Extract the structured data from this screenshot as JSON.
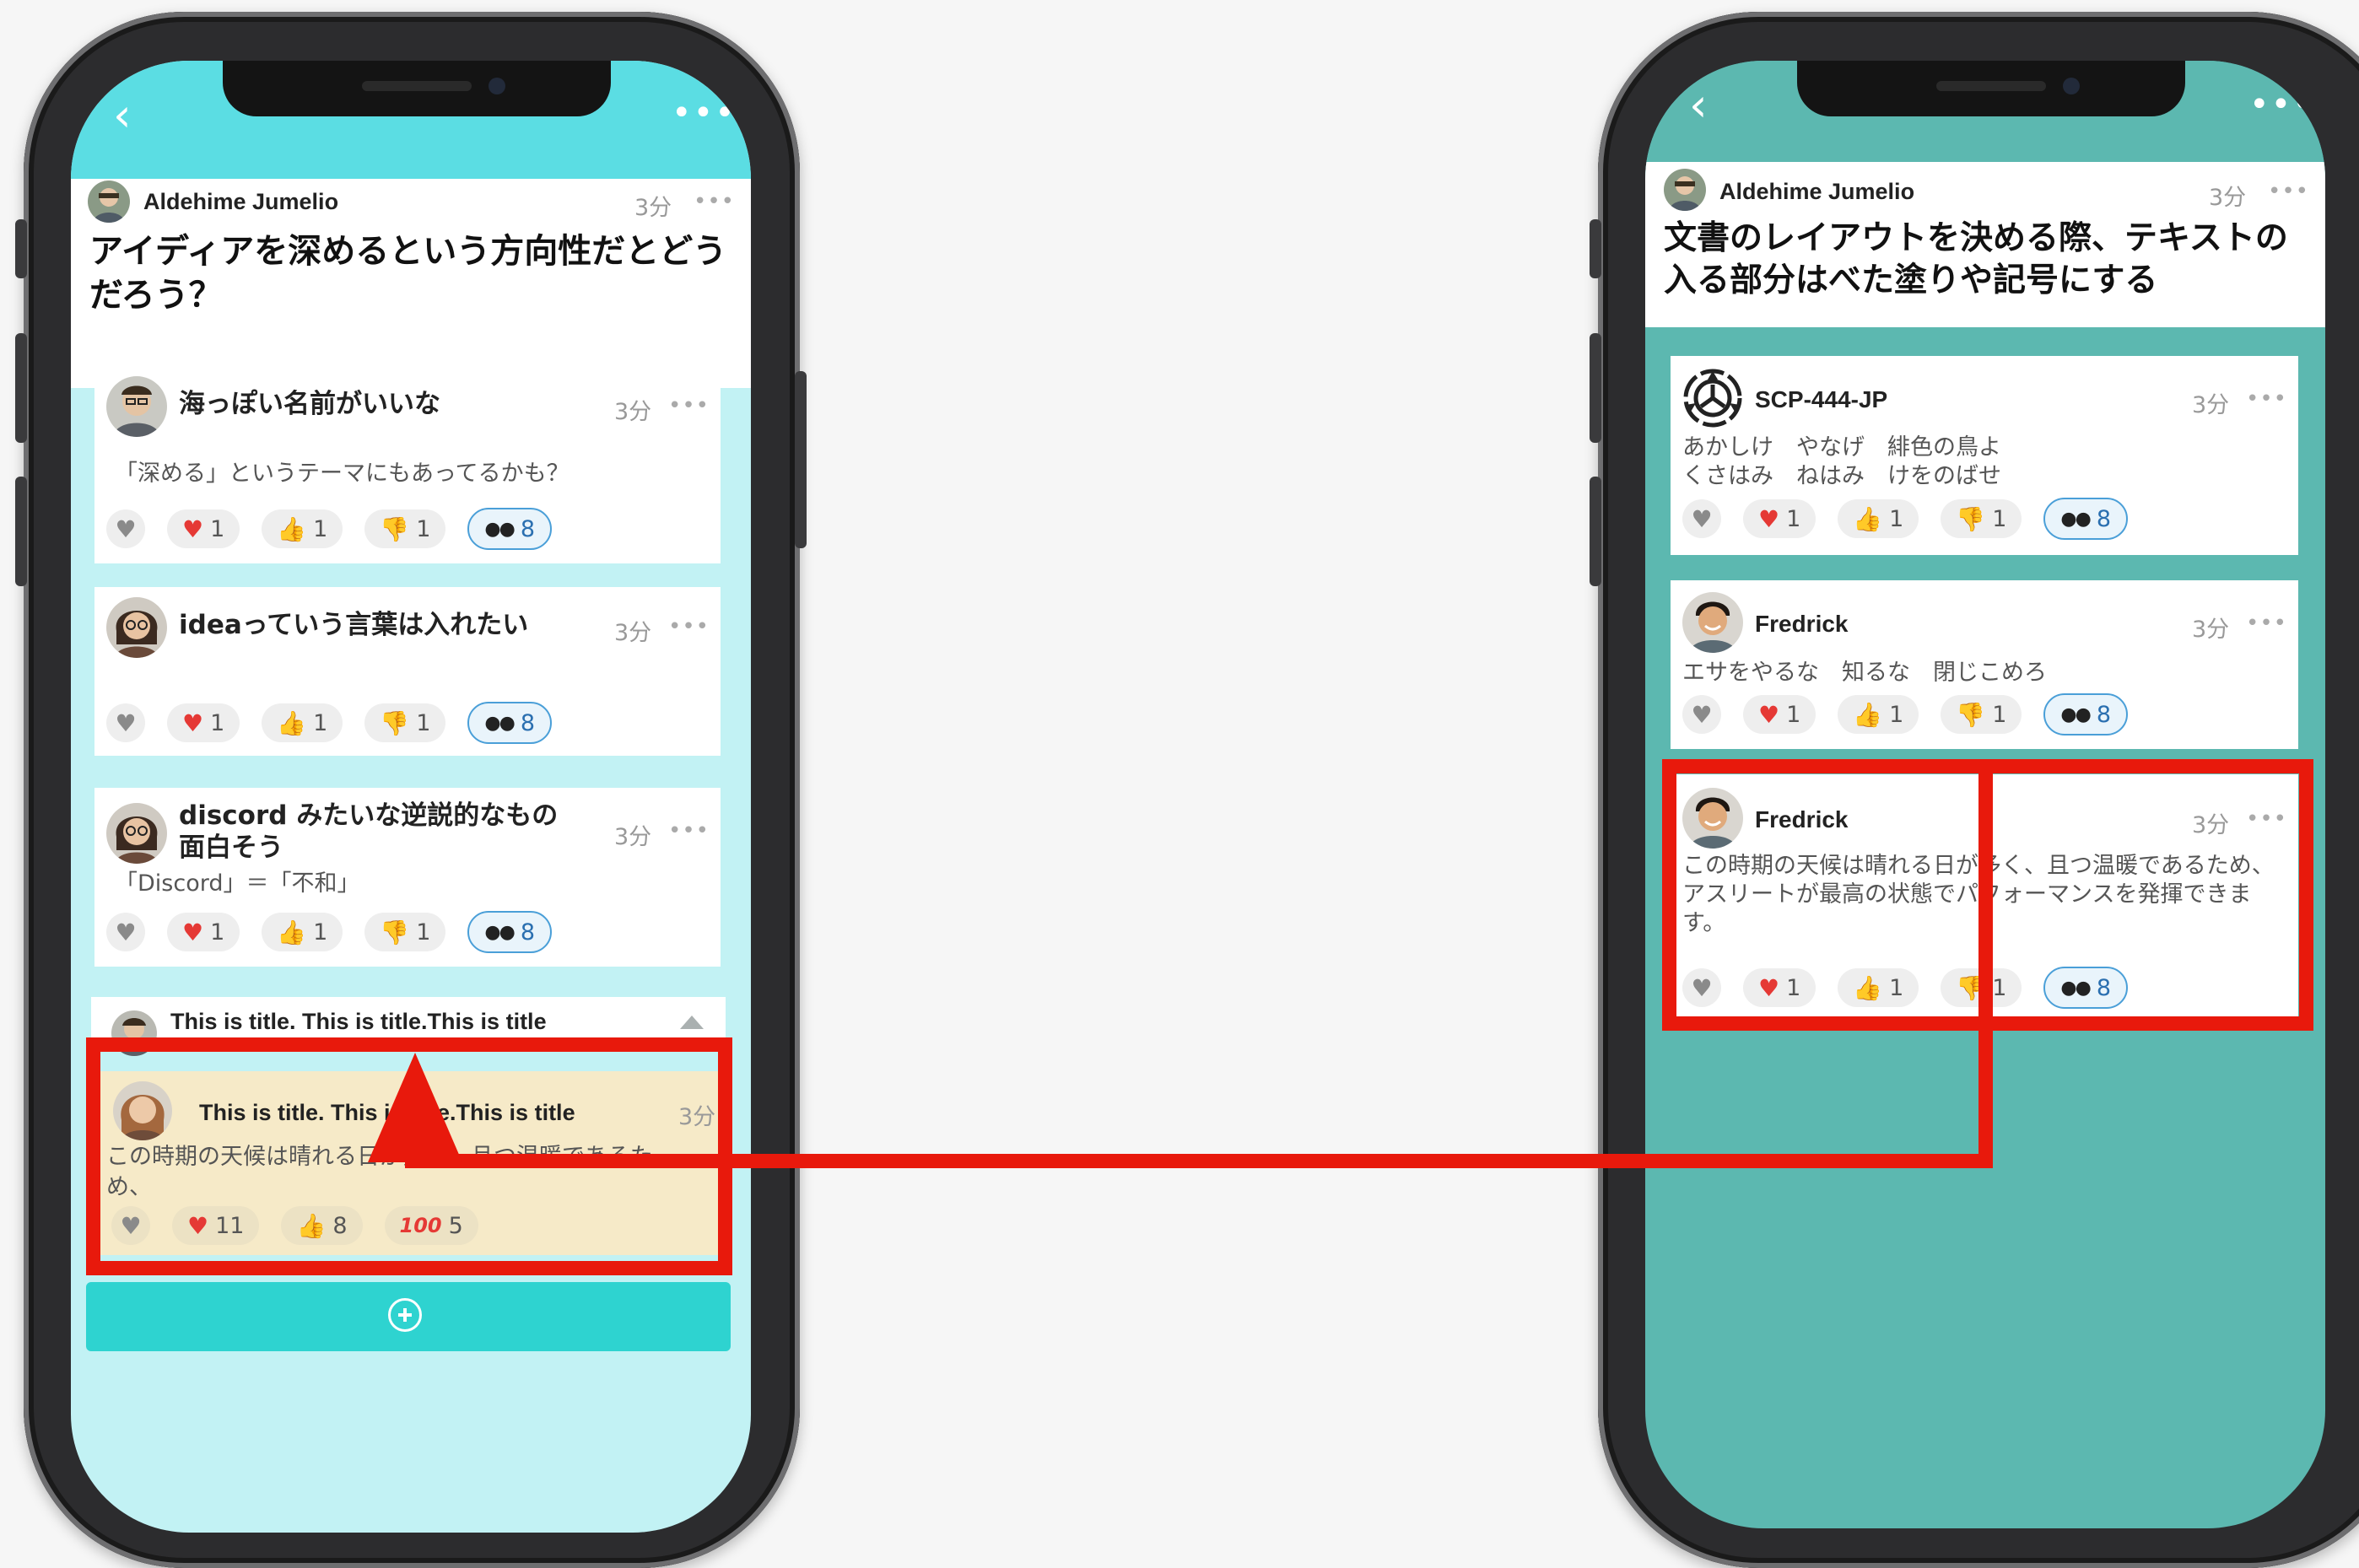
{
  "colors": {
    "accent_left": "#5bdde3",
    "screen_left": "#c2f2f4",
    "accent_right": "#5cb8b0",
    "highlight": "#e8190c",
    "new_post_bg": "#f6eac8"
  },
  "left": {
    "post": {
      "author": "Aldehime Jumelio",
      "time": "3分",
      "title": "アイディアを深めるという方向性だとどうだろう？"
    },
    "cards": [
      {
        "title": "海っぽい名前がいいな",
        "time": "3分",
        "body": "「深める」というテーマにもあってるかも？",
        "reactions": {
          "heart": "1",
          "thumbs_up": "1",
          "thumbs_down": "1",
          "eyes": "8"
        }
      },
      {
        "title": "ideaっていう言葉は入れたい",
        "time": "3分",
        "body": "",
        "reactions": {
          "heart": "1",
          "thumbs_up": "1",
          "thumbs_down": "1",
          "eyes": "8"
        }
      },
      {
        "title": "discord みたいな逆説的なもの面白そう",
        "time": "3分",
        "body": "「Discord」＝「不和」",
        "reactions": {
          "heart": "1",
          "thumbs_up": "1",
          "thumbs_down": "1",
          "eyes": "8"
        }
      }
    ],
    "collapsed": {
      "title": "This is title. This is title.This is title",
      "icon": "chevron-up-icon"
    },
    "new_post": {
      "title": "This is title. This is title.This is title",
      "time": "3分",
      "body": "この時期の天候は晴れる日が多く、且つ温暖であるため、",
      "reactions": {
        "heart": "11",
        "thumbs_up": "8",
        "hundred": "5"
      }
    },
    "add_button": {
      "icon": "plus-circle-icon"
    }
  },
  "right": {
    "post": {
      "author": "Aldehime Jumelio",
      "time": "3分",
      "title": "文書のレイアウトを決める際、テキストの入る部分はべた塗りや記号にする"
    },
    "cards": [
      {
        "author": "SCP-444-JP",
        "time": "3分",
        "body_line1": "あかしけ　やなげ　緋色の鳥よ",
        "body_line2": "くさはみ　ねはみ　けをのばせ",
        "reactions": {
          "heart": "1",
          "thumbs_up": "1",
          "thumbs_down": "1",
          "eyes": "8"
        }
      },
      {
        "author": "Fredrick",
        "time": "3分",
        "body": "エサをやるな　知るな　閉じこめろ",
        "reactions": {
          "heart": "1",
          "thumbs_up": "1",
          "thumbs_down": "1",
          "eyes": "8"
        }
      },
      {
        "author": "Fredrick",
        "time": "3分",
        "body": "この時期の天候は晴れる日が多く、且つ温暖であるため、アスリートが最高の状態でパフォーマンスを発揮できます。",
        "reactions": {
          "heart": "1",
          "thumbs_up": "1",
          "thumbs_down": "1",
          "eyes": "8"
        }
      }
    ]
  }
}
